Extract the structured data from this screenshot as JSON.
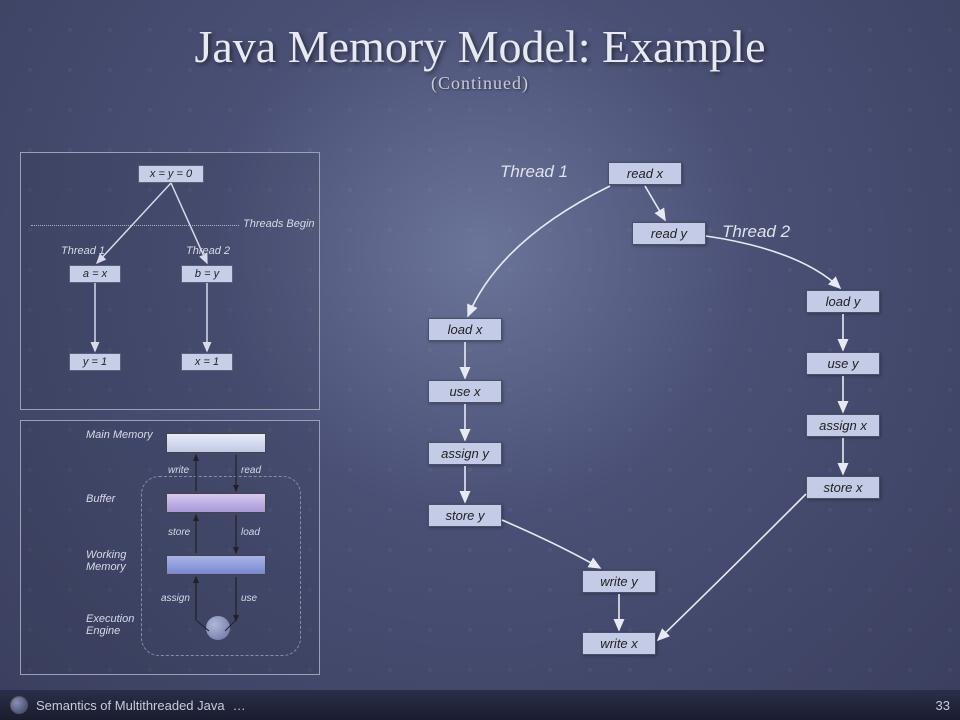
{
  "title": "Java Memory Model: Example",
  "subtitle": "(Continued)",
  "panel1": {
    "init": "x = y = 0",
    "threads_begin": "Threads Begin",
    "t1": "Thread 1",
    "t2": "Thread 2",
    "a": "a = x",
    "b": "b = y",
    "y1": "y = 1",
    "x1": "x = 1"
  },
  "panel2": {
    "main": "Main Memory",
    "buffer": "Buffer",
    "working": "Working Memory",
    "engine": "Execution Engine",
    "write": "write",
    "read": "read",
    "store": "store",
    "load": "load",
    "assign": "assign",
    "use": "use"
  },
  "flow": {
    "t1": "Thread 1",
    "t2": "Thread 2",
    "readx": "read x",
    "ready": "read y",
    "loadx": "load x",
    "usex": "use x",
    "assigny": "assign y",
    "storey": "store y",
    "writey": "write y",
    "loady": "load y",
    "usey": "use y",
    "assignx": "assign x",
    "storex": "store x",
    "writex": "write x"
  },
  "footer": {
    "text": "Semantics of Multithreaded Java",
    "page": "33"
  }
}
